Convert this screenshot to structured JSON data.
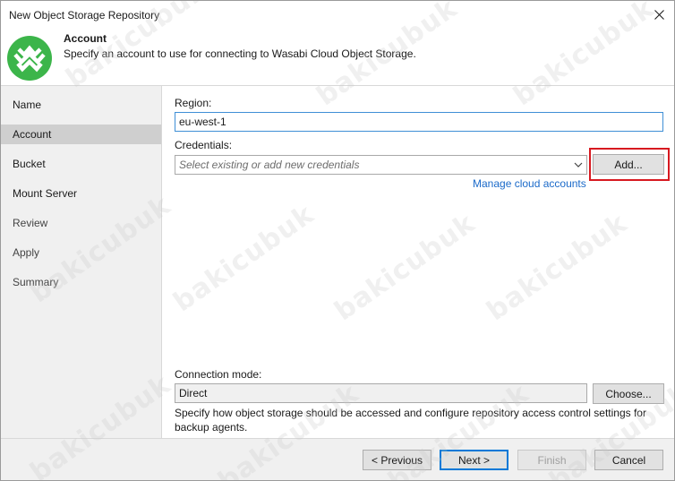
{
  "window": {
    "title": "New Object Storage Repository"
  },
  "header": {
    "title": "Account",
    "description": "Specify an account to use for connecting to Wasabi Cloud Object Storage.",
    "logo_icon": "wasabi-logo-icon",
    "logo_color": "#3cb54a"
  },
  "nav": {
    "items": [
      {
        "label": "Name"
      },
      {
        "label": "Account",
        "selected": true
      },
      {
        "label": "Bucket"
      },
      {
        "label": "Mount Server"
      },
      {
        "label": "Review"
      },
      {
        "label": "Apply"
      },
      {
        "label": "Summary"
      }
    ]
  },
  "form": {
    "region_label": "Region:",
    "region_value": "eu-west-1",
    "credentials_label": "Credentials:",
    "credentials_placeholder": "Select existing or add new credentials",
    "add_button": "Add...",
    "manage_link": "Manage cloud accounts",
    "connection_mode_label": "Connection mode:",
    "connection_mode_value": "Direct",
    "choose_button": "Choose...",
    "connection_help": "Specify how object storage should be accessed and configure repository access control settings for backup agents."
  },
  "footer": {
    "previous": "< Previous",
    "next": "Next >",
    "finish": "Finish",
    "cancel": "Cancel"
  },
  "watermark": "bakicubuk",
  "colors": {
    "accent": "#0078d7",
    "link": "#1b6ac9",
    "highlight": "#d71920",
    "nav_selected": "#cfcfcf"
  }
}
